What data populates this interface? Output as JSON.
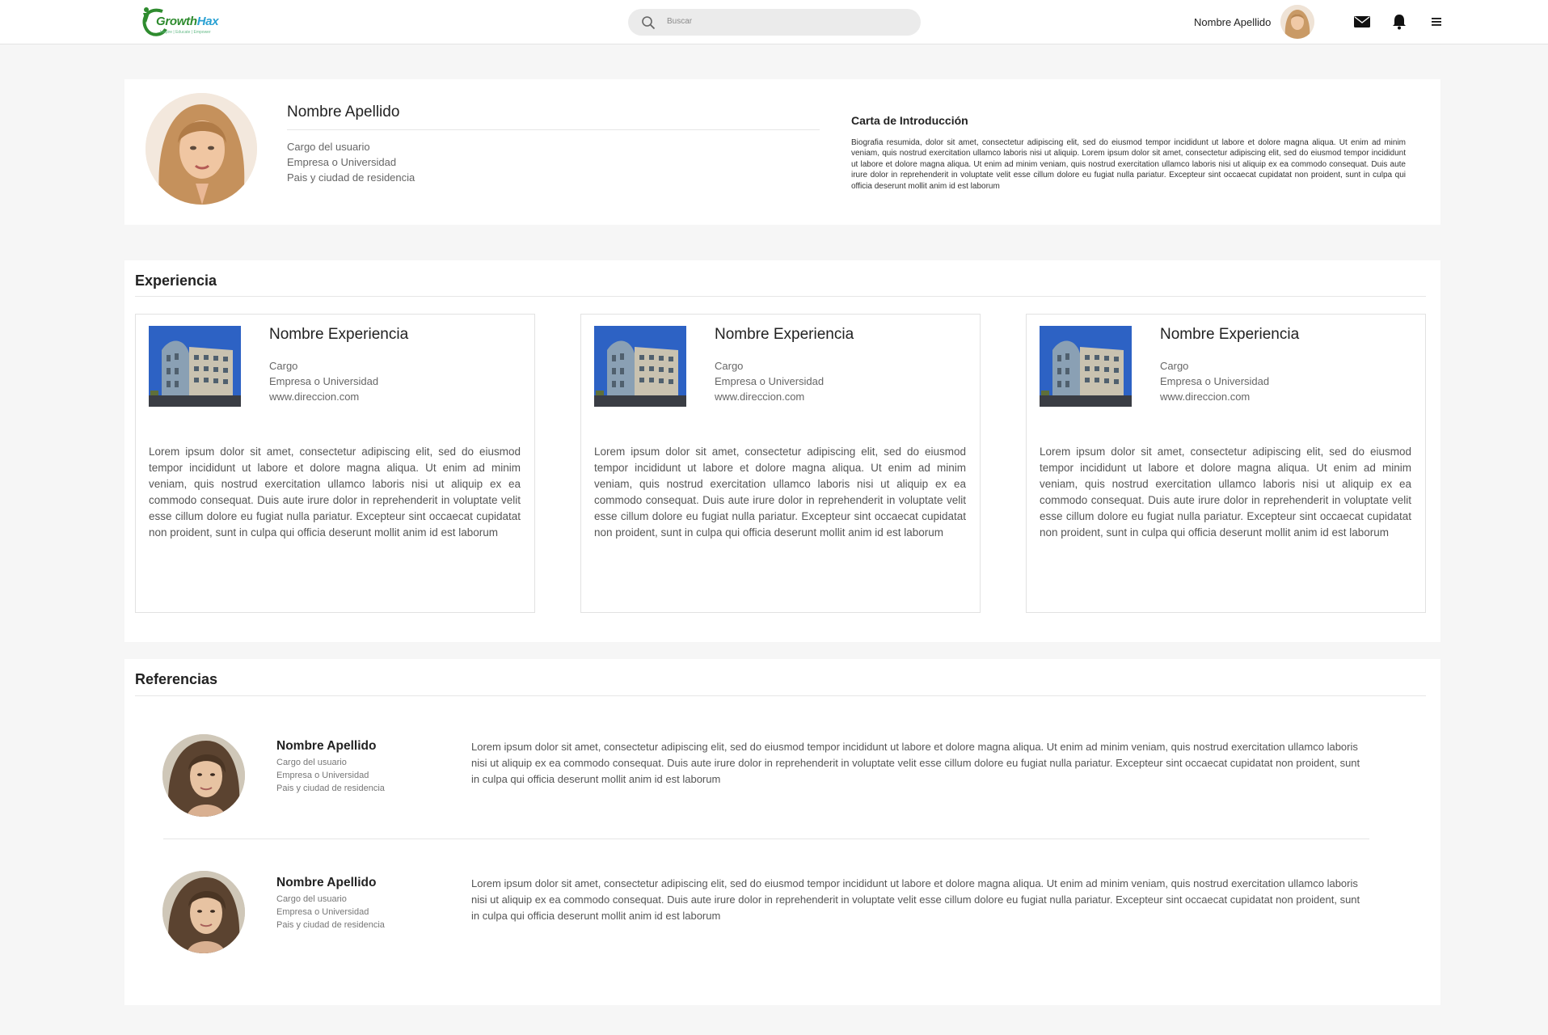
{
  "navbar": {
    "logo_text_main": "Growth",
    "logo_text_accent": "Hax",
    "logo_tagline": "Inspire | Educate | Empower",
    "search_placeholder": "Buscar",
    "user_name": "Nombre Apellido",
    "icons": [
      "mail-icon",
      "bell-icon",
      "menu-icon"
    ]
  },
  "profile": {
    "name": "Nombre Apellido",
    "role": "Cargo del usuario",
    "company": "Empresa o Universidad",
    "location": "Pais y ciudad de residencia",
    "intro_title": "Carta de Introducción",
    "intro_text": "Biografia resumida, dolor sit amet, consectetur adipiscing elit, sed do eiusmod tempor incididunt ut labore et dolore magna aliqua. Ut enim ad minim veniam, quis nostrud exercitation ullamco laboris nisi ut aliquip. Lorem ipsum dolor sit amet, consectetur adipiscing elit, sed do eiusmod tempor incididunt ut labore et dolore magna aliqua. Ut enim ad minim veniam, quis nostrud exercitation ullamco laboris nisi ut aliquip ex ea commodo consequat. Duis aute irure dolor in reprehenderit in voluptate velit esse cillum dolore eu fugiat nulla pariatur. Excepteur sint occaecat cupidatat non proident, sunt in culpa qui officia deserunt mollit anim id est laborum"
  },
  "experience": {
    "title": "Experiencia",
    "items": [
      {
        "name": "Nombre Experiencia",
        "role": "Cargo",
        "company": "Empresa o Universidad",
        "url": "www.direccion.com",
        "description": "Lorem ipsum dolor sit amet, consectetur adipiscing elit, sed do eiusmod tempor incididunt ut labore et dolore magna aliqua. Ut enim ad minim veniam, quis nostrud exercitation ullamco laboris nisi ut aliquip ex ea commodo consequat. Duis aute irure dolor in reprehenderit in voluptate velit esse cillum dolore eu fugiat nulla pariatur. Excepteur sint occaecat cupidatat non proident, sunt in culpa qui officia deserunt mollit anim id est laborum"
      },
      {
        "name": "Nombre Experiencia",
        "role": "Cargo",
        "company": "Empresa o Universidad",
        "url": "www.direccion.com",
        "description": "Lorem ipsum dolor sit amet, consectetur adipiscing elit, sed do eiusmod tempor incididunt ut labore et dolore magna aliqua. Ut enim ad minim veniam, quis nostrud exercitation ullamco laboris nisi ut aliquip ex ea commodo consequat. Duis aute irure dolor in reprehenderit in voluptate velit esse cillum dolore eu fugiat nulla pariatur. Excepteur sint occaecat cupidatat non proident, sunt in culpa qui officia deserunt mollit anim id est laborum"
      },
      {
        "name": "Nombre Experiencia",
        "role": "Cargo",
        "company": "Empresa o Universidad",
        "url": "www.direccion.com",
        "description": "Lorem ipsum dolor sit amet, consectetur adipiscing elit, sed do eiusmod tempor incididunt ut labore et dolore magna aliqua. Ut enim ad minim veniam, quis nostrud exercitation ullamco laboris nisi ut aliquip ex ea commodo consequat. Duis aute irure dolor in reprehenderit in voluptate velit esse cillum dolore eu fugiat nulla pariatur. Excepteur sint occaecat cupidatat non proident, sunt in culpa qui officia deserunt mollit anim id est laborum"
      }
    ]
  },
  "references": {
    "title": "Referencias",
    "items": [
      {
        "name": "Nombre Apellido",
        "role": "Cargo del usuario",
        "company": "Empresa o Universidad",
        "location": "Pais y ciudad de residencia",
        "text": "Lorem ipsum dolor sit amet, consectetur adipiscing elit, sed do eiusmod tempor incididunt ut labore et dolore magna aliqua. Ut enim ad minim veniam, quis nostrud exercitation ullamco laboris nisi ut aliquip ex ea commodo consequat. Duis aute irure dolor in reprehenderit in voluptate velit esse cillum dolore eu fugiat nulla pariatur. Excepteur sint occaecat cupidatat non proident, sunt in culpa qui officia deserunt mollit anim id est laborum"
      },
      {
        "name": "Nombre Apellido",
        "role": "Cargo del usuario",
        "company": "Empresa o Universidad",
        "location": "Pais y ciudad de residencia",
        "text": "Lorem ipsum dolor sit amet, consectetur adipiscing elit, sed do eiusmod tempor incididunt ut labore et dolore magna aliqua. Ut enim ad minim veniam, quis nostrud exercitation ullamco laboris nisi ut aliquip ex ea commodo consequat. Duis aute irure dolor in reprehenderit in voluptate velit esse cillum dolore eu fugiat nulla pariatur. Excepteur sint occaecat cupidatat non proident, sunt in culpa qui officia deserunt mollit anim id est laborum"
      }
    ]
  },
  "colors": {
    "page_bg": "#f6f6f6",
    "card_bg": "#ffffff",
    "logo_green": "#2e8b2e",
    "logo_blue": "#2aa1d3"
  }
}
